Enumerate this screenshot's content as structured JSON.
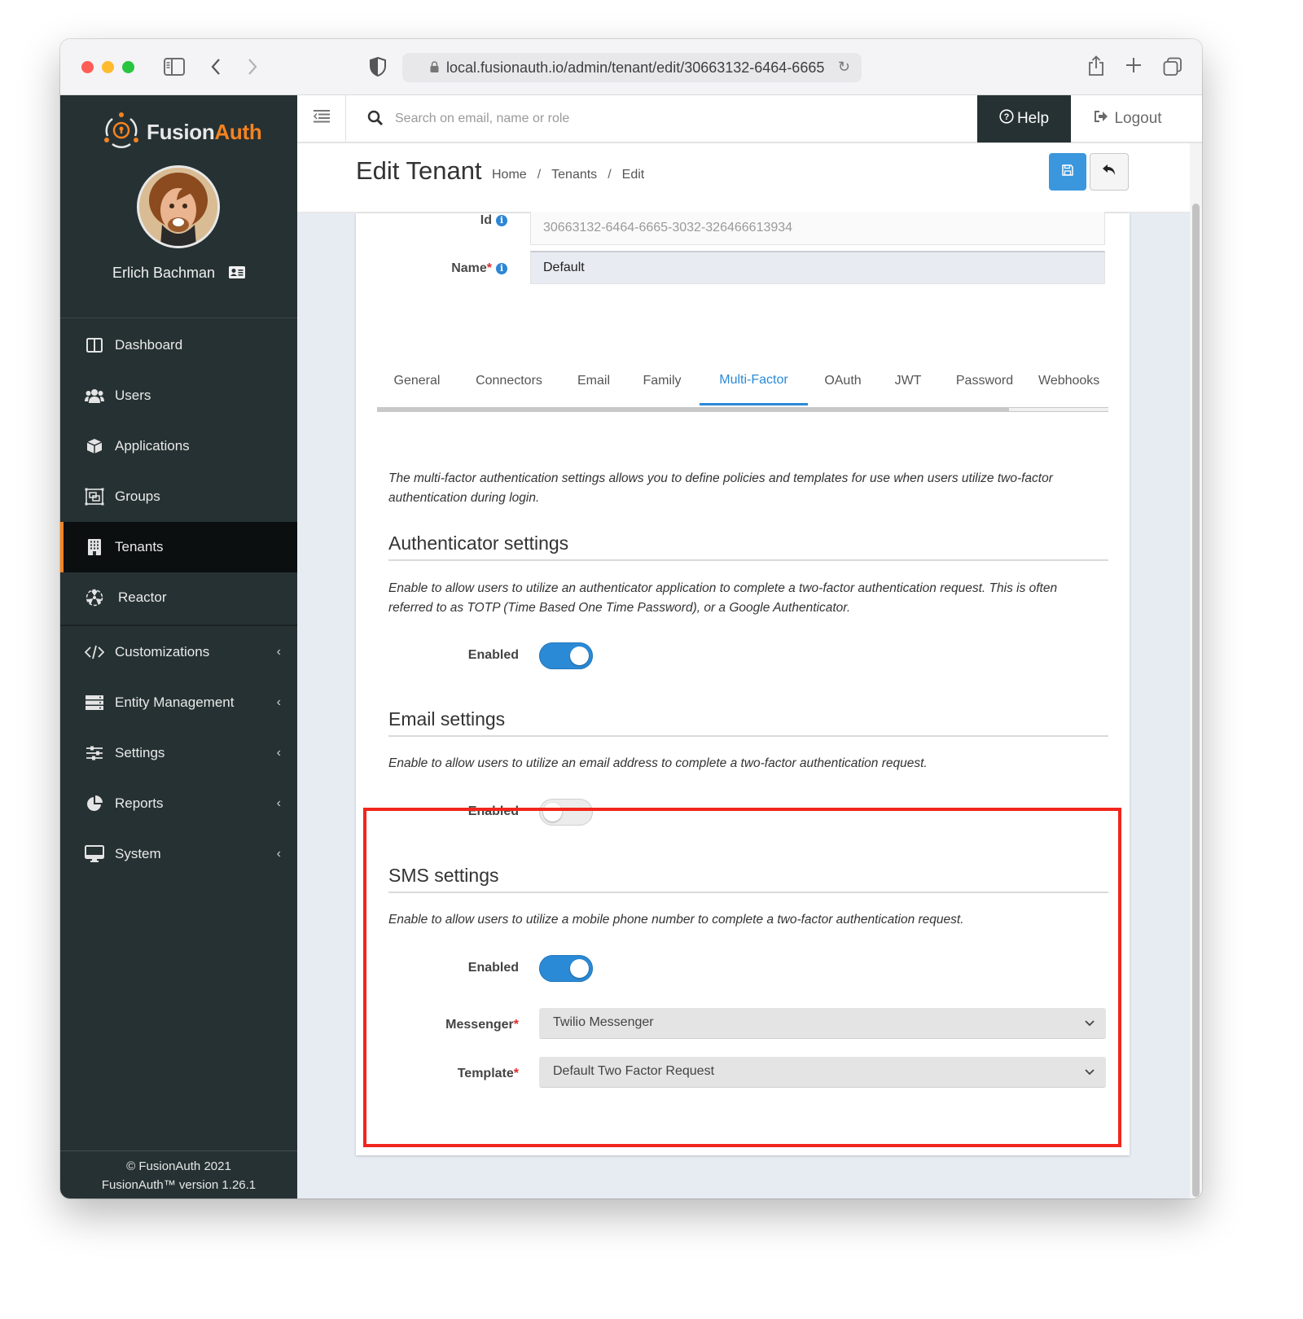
{
  "browser": {
    "url": "local.fusionauth.io/admin/tenant/edit/30663132-6464-6665",
    "icons": [
      "sidebar-toggle-icon",
      "back-icon",
      "forward-icon",
      "shield-icon",
      "lock-icon",
      "reload-icon",
      "share-icon",
      "new-tab-icon",
      "tabs-overview-icon"
    ]
  },
  "sidebar": {
    "brand": {
      "part1": "Fusion",
      "part2": "Auth"
    },
    "user_name": "Erlich Bachman",
    "items": [
      {
        "label": "Dashboard",
        "icon": "dashboard-icon",
        "active": false,
        "expandable": false
      },
      {
        "label": "Users",
        "icon": "users-icon",
        "active": false,
        "expandable": false
      },
      {
        "label": "Applications",
        "icon": "cube-icon",
        "active": false,
        "expandable": false
      },
      {
        "label": "Groups",
        "icon": "groups-icon",
        "active": false,
        "expandable": false
      },
      {
        "label": "Tenants",
        "icon": "building-icon",
        "active": true,
        "expandable": false
      },
      {
        "label": "Reactor",
        "icon": "reactor-icon",
        "active": false,
        "expandable": false
      },
      {
        "label": "Customizations",
        "icon": "code-icon",
        "active": false,
        "expandable": true
      },
      {
        "label": "Entity Management",
        "icon": "server-icon",
        "active": false,
        "expandable": true
      },
      {
        "label": "Settings",
        "icon": "sliders-icon",
        "active": false,
        "expandable": true
      },
      {
        "label": "Reports",
        "icon": "pie-chart-icon",
        "active": false,
        "expandable": true
      },
      {
        "label": "System",
        "icon": "desktop-icon",
        "active": false,
        "expandable": true
      }
    ],
    "footer": {
      "copyright": "© FusionAuth 2021",
      "version": "FusionAuth™ version 1.26.1"
    }
  },
  "topbar": {
    "search_placeholder": "Search on email, name or role",
    "help_label": "Help",
    "logout_label": "Logout"
  },
  "header": {
    "title": "Edit Tenant",
    "breadcrumb": [
      "Home",
      "Tenants",
      "Edit"
    ],
    "separator": "/"
  },
  "form": {
    "id_label": "Id",
    "id_value": "30663132-6464-6665-3032-326466613934",
    "name_label": "Name",
    "name_value": "Default",
    "required_mark": "*"
  },
  "tabs": [
    {
      "label": "General",
      "active": false
    },
    {
      "label": "Connectors",
      "active": false
    },
    {
      "label": "Email",
      "active": false
    },
    {
      "label": "Family",
      "active": false
    },
    {
      "label": "Multi-Factor",
      "active": true
    },
    {
      "label": "OAuth",
      "active": false
    },
    {
      "label": "JWT",
      "active": false
    },
    {
      "label": "Password",
      "active": false
    },
    {
      "label": "Webhooks",
      "active": false
    }
  ],
  "mfa": {
    "intro": "The multi-factor authentication settings allows you to define policies and templates for use when users utilize two-factor authentication during login.",
    "authenticator": {
      "title": "Authenticator settings",
      "description": "Enable to allow users to utilize an authenticator application to complete a two-factor authentication request. This is often referred to as TOTP (Time Based One Time Password), or a Google Authenticator.",
      "enabled_label": "Enabled",
      "enabled": true
    },
    "email": {
      "title": "Email settings",
      "description": "Enable to allow users to utilize an email address to complete a two-factor authentication request.",
      "enabled_label": "Enabled",
      "enabled": false
    },
    "sms": {
      "title": "SMS settings",
      "description": "Enable to allow users to utilize a mobile phone number to complete a two-factor authentication request.",
      "enabled_label": "Enabled",
      "enabled": true,
      "messenger_label": "Messenger",
      "messenger_value": "Twilio Messenger",
      "template_label": "Template",
      "template_value": "Default Two Factor Request"
    }
  },
  "annotation": {
    "highlight_color": "#f2261c",
    "highlights": "SMS settings"
  },
  "colors": {
    "brand_orange": "#f58320",
    "accent_blue": "#2b8ad6",
    "sidebar_bg": "#263133"
  }
}
